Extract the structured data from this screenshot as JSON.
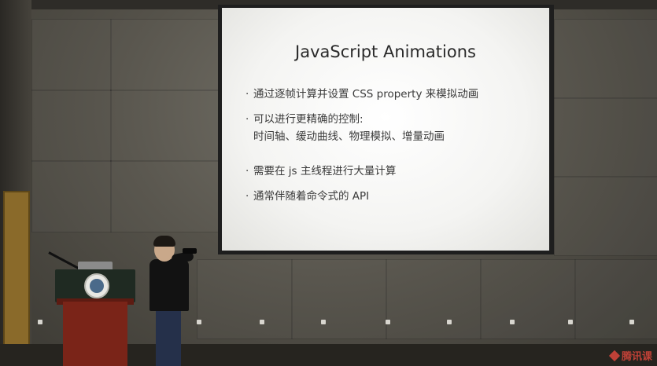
{
  "slide": {
    "title": "JavaScript Animations",
    "bullets": [
      {
        "dot": "·",
        "text": "通过逐帧计算并设置 CSS property 来模拟动画"
      },
      {
        "dot": "·",
        "text": "可以进行更精确的控制:"
      },
      {
        "dot": "·",
        "text": "需要在 js 主线程进行大量计算"
      },
      {
        "dot": "·",
        "text": "通常伴随着命令式的 API"
      }
    ],
    "sub_line": "时间轴、缓动曲线、物理模拟、增量动画"
  },
  "watermark": {
    "text": "腾讯课"
  }
}
